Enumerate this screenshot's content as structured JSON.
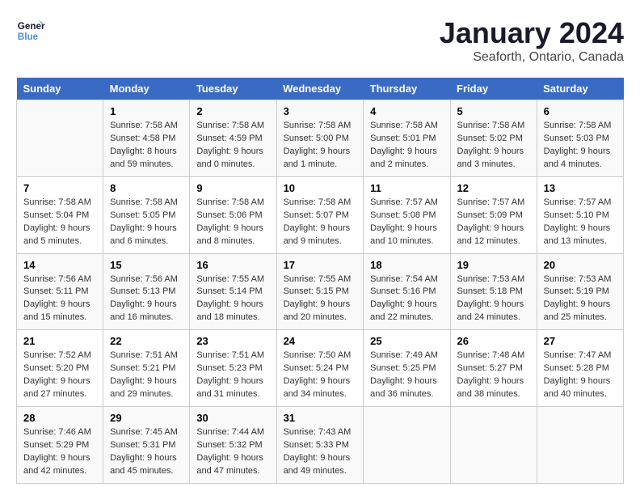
{
  "header": {
    "logo_line1": "General",
    "logo_line2": "Blue",
    "title": "January 2024",
    "subtitle": "Seaforth, Ontario, Canada"
  },
  "days_of_week": [
    "Sunday",
    "Monday",
    "Tuesday",
    "Wednesday",
    "Thursday",
    "Friday",
    "Saturday"
  ],
  "weeks": [
    [
      {
        "day": "",
        "info": ""
      },
      {
        "day": "1",
        "info": "Sunrise: 7:58 AM\nSunset: 4:58 PM\nDaylight: 8 hours\nand 59 minutes."
      },
      {
        "day": "2",
        "info": "Sunrise: 7:58 AM\nSunset: 4:59 PM\nDaylight: 9 hours\nand 0 minutes."
      },
      {
        "day": "3",
        "info": "Sunrise: 7:58 AM\nSunset: 5:00 PM\nDaylight: 9 hours\nand 1 minute."
      },
      {
        "day": "4",
        "info": "Sunrise: 7:58 AM\nSunset: 5:01 PM\nDaylight: 9 hours\nand 2 minutes."
      },
      {
        "day": "5",
        "info": "Sunrise: 7:58 AM\nSunset: 5:02 PM\nDaylight: 9 hours\nand 3 minutes."
      },
      {
        "day": "6",
        "info": "Sunrise: 7:58 AM\nSunset: 5:03 PM\nDaylight: 9 hours\nand 4 minutes."
      }
    ],
    [
      {
        "day": "7",
        "info": "Sunrise: 7:58 AM\nSunset: 5:04 PM\nDaylight: 9 hours\nand 5 minutes."
      },
      {
        "day": "8",
        "info": "Sunrise: 7:58 AM\nSunset: 5:05 PM\nDaylight: 9 hours\nand 6 minutes."
      },
      {
        "day": "9",
        "info": "Sunrise: 7:58 AM\nSunset: 5:06 PM\nDaylight: 9 hours\nand 8 minutes."
      },
      {
        "day": "10",
        "info": "Sunrise: 7:58 AM\nSunset: 5:07 PM\nDaylight: 9 hours\nand 9 minutes."
      },
      {
        "day": "11",
        "info": "Sunrise: 7:57 AM\nSunset: 5:08 PM\nDaylight: 9 hours\nand 10 minutes."
      },
      {
        "day": "12",
        "info": "Sunrise: 7:57 AM\nSunset: 5:09 PM\nDaylight: 9 hours\nand 12 minutes."
      },
      {
        "day": "13",
        "info": "Sunrise: 7:57 AM\nSunset: 5:10 PM\nDaylight: 9 hours\nand 13 minutes."
      }
    ],
    [
      {
        "day": "14",
        "info": "Sunrise: 7:56 AM\nSunset: 5:11 PM\nDaylight: 9 hours\nand 15 minutes."
      },
      {
        "day": "15",
        "info": "Sunrise: 7:56 AM\nSunset: 5:13 PM\nDaylight: 9 hours\nand 16 minutes."
      },
      {
        "day": "16",
        "info": "Sunrise: 7:55 AM\nSunset: 5:14 PM\nDaylight: 9 hours\nand 18 minutes."
      },
      {
        "day": "17",
        "info": "Sunrise: 7:55 AM\nSunset: 5:15 PM\nDaylight: 9 hours\nand 20 minutes."
      },
      {
        "day": "18",
        "info": "Sunrise: 7:54 AM\nSunset: 5:16 PM\nDaylight: 9 hours\nand 22 minutes."
      },
      {
        "day": "19",
        "info": "Sunrise: 7:53 AM\nSunset: 5:18 PM\nDaylight: 9 hours\nand 24 minutes."
      },
      {
        "day": "20",
        "info": "Sunrise: 7:53 AM\nSunset: 5:19 PM\nDaylight: 9 hours\nand 25 minutes."
      }
    ],
    [
      {
        "day": "21",
        "info": "Sunrise: 7:52 AM\nSunset: 5:20 PM\nDaylight: 9 hours\nand 27 minutes."
      },
      {
        "day": "22",
        "info": "Sunrise: 7:51 AM\nSunset: 5:21 PM\nDaylight: 9 hours\nand 29 minutes."
      },
      {
        "day": "23",
        "info": "Sunrise: 7:51 AM\nSunset: 5:23 PM\nDaylight: 9 hours\nand 31 minutes."
      },
      {
        "day": "24",
        "info": "Sunrise: 7:50 AM\nSunset: 5:24 PM\nDaylight: 9 hours\nand 34 minutes."
      },
      {
        "day": "25",
        "info": "Sunrise: 7:49 AM\nSunset: 5:25 PM\nDaylight: 9 hours\nand 36 minutes."
      },
      {
        "day": "26",
        "info": "Sunrise: 7:48 AM\nSunset: 5:27 PM\nDaylight: 9 hours\nand 38 minutes."
      },
      {
        "day": "27",
        "info": "Sunrise: 7:47 AM\nSunset: 5:28 PM\nDaylight: 9 hours\nand 40 minutes."
      }
    ],
    [
      {
        "day": "28",
        "info": "Sunrise: 7:46 AM\nSunset: 5:29 PM\nDaylight: 9 hours\nand 42 minutes."
      },
      {
        "day": "29",
        "info": "Sunrise: 7:45 AM\nSunset: 5:31 PM\nDaylight: 9 hours\nand 45 minutes."
      },
      {
        "day": "30",
        "info": "Sunrise: 7:44 AM\nSunset: 5:32 PM\nDaylight: 9 hours\nand 47 minutes."
      },
      {
        "day": "31",
        "info": "Sunrise: 7:43 AM\nSunset: 5:33 PM\nDaylight: 9 hours\nand 49 minutes."
      },
      {
        "day": "",
        "info": ""
      },
      {
        "day": "",
        "info": ""
      },
      {
        "day": "",
        "info": ""
      }
    ]
  ]
}
